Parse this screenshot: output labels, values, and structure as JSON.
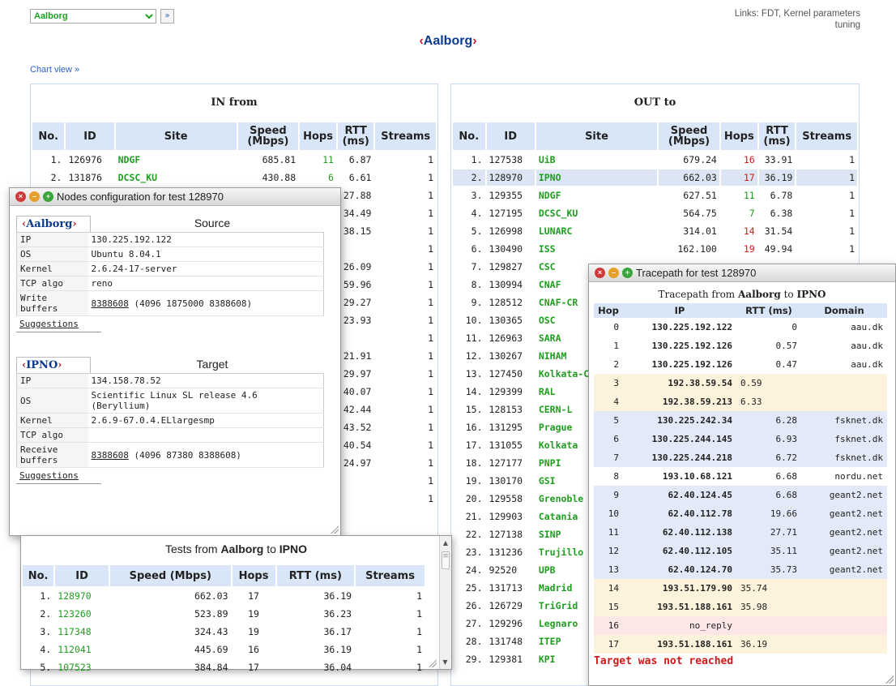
{
  "header": {
    "site_select": "Aalborg",
    "go_button": "»",
    "links_line1": "Links: FDT, Kernel parameters",
    "links_line2": "tuning",
    "title_open": "‹",
    "title": "Aalborg",
    "title_close": "›",
    "chart_view": "Chart view »"
  },
  "in_panel": {
    "title": "IN from",
    "columns": [
      "No.",
      "ID",
      "Site",
      "Speed (Mbps)",
      "Hops",
      "RTT (ms)",
      "Streams"
    ],
    "rows": [
      {
        "no": "1.",
        "id": "126976",
        "site": "NDGF",
        "speed": "685.81",
        "hops": "11",
        "rtt": "6.87",
        "streams": "1"
      },
      {
        "no": "2.",
        "id": "131876",
        "site": "DCSC_KU",
        "speed": "430.88",
        "hops": "6",
        "rtt": "6.61",
        "streams": "1"
      },
      {
        "rtt": "27.88",
        "streams": "1"
      },
      {
        "rtt": "34.49",
        "streams": "1"
      },
      {
        "rtt": "38.15",
        "streams": "1"
      },
      {
        "rtt": "",
        "streams": "1"
      },
      {
        "rtt": "26.09",
        "streams": "1"
      },
      {
        "rtt": "59.96",
        "streams": "1"
      },
      {
        "rtt": "29.27",
        "streams": "1"
      },
      {
        "rtt": "23.93",
        "streams": "1"
      },
      {
        "rtt": "",
        "streams": "1"
      },
      {
        "rtt": "21.91",
        "streams": "1"
      },
      {
        "rtt": "29.97",
        "streams": "1"
      },
      {
        "rtt": "40.07",
        "streams": "1"
      },
      {
        "rtt": "42.44",
        "streams": "1"
      },
      {
        "rtt": "43.52",
        "streams": "1"
      },
      {
        "rtt": "40.54",
        "streams": "1"
      },
      {
        "rtt": "24.97",
        "streams": "1"
      },
      {
        "rtt": "",
        "streams": "1"
      },
      {
        "rtt": "",
        "streams": "1"
      }
    ]
  },
  "out_panel": {
    "title": "OUT to",
    "columns": [
      "No.",
      "ID",
      "Site",
      "Speed (Mbps)",
      "Hops",
      "RTT (ms)",
      "Streams"
    ],
    "rows": [
      {
        "no": "1.",
        "id": "127538",
        "site": "UiB",
        "speed": "679.24",
        "hops": "16",
        "rtt": "33.91",
        "streams": "1"
      },
      {
        "no": "2.",
        "id": "128970",
        "site": "IPNO",
        "speed": "662.03",
        "hops": "17",
        "rtt": "36.19",
        "streams": "1"
      },
      {
        "no": "3.",
        "id": "129355",
        "site": "NDGF",
        "speed": "627.51",
        "hops": "11",
        "rtt": "6.78",
        "streams": "1"
      },
      {
        "no": "4.",
        "id": "127195",
        "site": "DCSC_KU",
        "speed": "564.75",
        "hops": "7",
        "rtt": "6.38",
        "streams": "1"
      },
      {
        "no": "5.",
        "id": "126998",
        "site": "LUNARC",
        "speed": "314.01",
        "hops": "14",
        "rtt": "31.54",
        "streams": "1"
      },
      {
        "no": "6.",
        "id": "130490",
        "site": "ISS",
        "speed": "162.100",
        "hops": "19",
        "rtt": "49.94",
        "streams": "1"
      },
      {
        "no": "7.",
        "id": "129827",
        "site": "CSC"
      },
      {
        "no": "8.",
        "id": "130994",
        "site": "CNAF"
      },
      {
        "no": "9.",
        "id": "128512",
        "site": "CNAF-CR"
      },
      {
        "no": "10.",
        "id": "130365",
        "site": "OSC"
      },
      {
        "no": "11.",
        "id": "126963",
        "site": "SARA"
      },
      {
        "no": "12.",
        "id": "130267",
        "site": "NIHAM"
      },
      {
        "no": "13.",
        "id": "127450",
        "site": "Kolkata-C"
      },
      {
        "no": "14.",
        "id": "129399",
        "site": "RAL"
      },
      {
        "no": "15.",
        "id": "128153",
        "site": "CERN-L"
      },
      {
        "no": "16.",
        "id": "131295",
        "site": "Prague"
      },
      {
        "no": "17.",
        "id": "131055",
        "site": "Kolkata"
      },
      {
        "no": "18.",
        "id": "127177",
        "site": "PNPI"
      },
      {
        "no": "19.",
        "id": "130170",
        "site": "GSI"
      },
      {
        "no": "20.",
        "id": "129558",
        "site": "Grenoble"
      },
      {
        "no": "21.",
        "id": "129903",
        "site": "Catania"
      },
      {
        "no": "22.",
        "id": "127138",
        "site": "SINP"
      },
      {
        "no": "23.",
        "id": "131236",
        "site": "Trujillo"
      },
      {
        "no": "24.",
        "id": "92520",
        "site": "UPB"
      },
      {
        "no": "25.",
        "id": "131713",
        "site": "Madrid"
      },
      {
        "no": "26.",
        "id": "126729",
        "site": "TriGrid"
      },
      {
        "no": "27.",
        "id": "129296",
        "site": "Legnaro"
      },
      {
        "no": "28.",
        "id": "131748",
        "site": "ITEP"
      },
      {
        "no": "29.",
        "id": "129381",
        "site": "KPI"
      }
    ]
  },
  "nodes_window": {
    "title": "Nodes configuration for test 128970",
    "source": {
      "tab_open": "‹",
      "tab_name": "Aalborg",
      "tab_close": "›",
      "label": "Source",
      "fields": [
        {
          "label": "IP",
          "value": "130.225.192.122"
        },
        {
          "label": "OS",
          "value": "Ubuntu 8.04.1"
        },
        {
          "label": "Kernel",
          "value": "2.6.24-17-server"
        },
        {
          "label": "TCP algo",
          "value": "reno"
        },
        {
          "label": "Write buffers",
          "value_link": "8388608",
          "value_rest": " (4096 1875000 8388608)"
        }
      ],
      "suggestions": "Suggestions"
    },
    "target": {
      "tab_open": "‹",
      "tab_name": "IPNO",
      "tab_close": "›",
      "label": "Target",
      "fields": [
        {
          "label": "IP",
          "value": "134.158.78.52"
        },
        {
          "label": "OS",
          "value": "Scientific Linux SL release 4.6 (Beryllium)"
        },
        {
          "label": "Kernel",
          "value": "2.6.9-67.0.4.ELlargesmp"
        },
        {
          "label": "TCP algo",
          "value": ""
        },
        {
          "label": "Receive buffers",
          "value_link": "8388608",
          "value_rest": " (4096 87380 8388608)"
        }
      ],
      "suggestions": "Suggestions"
    }
  },
  "tests_window": {
    "title_prefix": "Tests from ",
    "title_from": "Aalborg",
    "title_mid": " to ",
    "title_to": "IPNO",
    "columns": [
      "No.",
      "ID",
      "Speed (Mbps)",
      "Hops",
      "RTT (ms)",
      "Streams"
    ],
    "rows": [
      {
        "no": "1.",
        "id": "128970",
        "speed": "662.03",
        "hops": "17",
        "rtt": "36.19",
        "streams": "1"
      },
      {
        "no": "2.",
        "id": "123260",
        "speed": "523.89",
        "hops": "19",
        "rtt": "36.23",
        "streams": "1"
      },
      {
        "no": "3.",
        "id": "117348",
        "speed": "324.43",
        "hops": "19",
        "rtt": "36.17",
        "streams": "1"
      },
      {
        "no": "4.",
        "id": "112041",
        "speed": "445.69",
        "hops": "16",
        "rtt": "36.19",
        "streams": "1"
      },
      {
        "no": "5.",
        "id": "107523",
        "speed": "384.84",
        "hops": "17",
        "rtt": "36.04",
        "streams": "1"
      }
    ]
  },
  "trace_window": {
    "title": "Tracepath for test 128970",
    "heading_prefix": "Tracepath from ",
    "heading_from": "Aalborg",
    "heading_mid": " to ",
    "heading_to": "IPNO",
    "columns": [
      "Hop",
      "IP",
      "RTT (ms)",
      "Domain"
    ],
    "rows": [
      {
        "hop": "0",
        "ip": "130.225.192.122",
        "rtt": "0",
        "domain": "aau.dk",
        "kind": "a"
      },
      {
        "hop": "1",
        "ip": "130.225.192.126",
        "rtt": "0.57",
        "domain": "aau.dk",
        "kind": "a"
      },
      {
        "hop": "2",
        "ip": "130.225.192.126",
        "rtt": "0.47",
        "domain": "aau.dk",
        "kind": "a"
      },
      {
        "hop": "3",
        "ip": "192.38.59.54",
        "rtt": "0.59",
        "domain": "",
        "kind": "b"
      },
      {
        "hop": "4",
        "ip": "192.38.59.213",
        "rtt": "6.33",
        "domain": "",
        "kind": "b"
      },
      {
        "hop": "5",
        "ip": "130.225.242.34",
        "rtt": "6.28",
        "domain": "fsknet.dk",
        "kind": "c"
      },
      {
        "hop": "6",
        "ip": "130.225.244.145",
        "rtt": "6.93",
        "domain": "fsknet.dk",
        "kind": "c"
      },
      {
        "hop": "7",
        "ip": "130.225.244.218",
        "rtt": "6.72",
        "domain": "fsknet.dk",
        "kind": "c"
      },
      {
        "hop": "8",
        "ip": "193.10.68.121",
        "rtt": "6.68",
        "domain": "nordu.net",
        "kind": "a"
      },
      {
        "hop": "9",
        "ip": "62.40.124.45",
        "rtt": "6.68",
        "domain": "geant2.net",
        "kind": "c"
      },
      {
        "hop": "10",
        "ip": "62.40.112.78",
        "rtt": "19.66",
        "domain": "geant2.net",
        "kind": "c"
      },
      {
        "hop": "11",
        "ip": "62.40.112.138",
        "rtt": "27.71",
        "domain": "geant2.net",
        "kind": "c"
      },
      {
        "hop": "12",
        "ip": "62.40.112.105",
        "rtt": "35.11",
        "domain": "geant2.net",
        "kind": "c"
      },
      {
        "hop": "13",
        "ip": "62.40.124.70",
        "rtt": "35.73",
        "domain": "geant2.net",
        "kind": "c"
      },
      {
        "hop": "14",
        "ip": "193.51.179.90",
        "rtt": "35.74",
        "domain": "",
        "kind": "b"
      },
      {
        "hop": "15",
        "ip": "193.51.188.161",
        "rtt": "35.98",
        "domain": "",
        "kind": "b"
      },
      {
        "hop": "16",
        "ip": "no_reply",
        "rtt": "",
        "domain": "",
        "kind": "d"
      },
      {
        "hop": "17",
        "ip": "193.51.188.161",
        "rtt": "36.19",
        "domain": "",
        "kind": "b"
      }
    ],
    "footer": "Target was not reached"
  },
  "colors": {
    "accent_blue": "#0a3a8f",
    "site_green": "#1e9e1e",
    "hops_red": "#d01919",
    "header_bg": "#d9e6f7"
  }
}
